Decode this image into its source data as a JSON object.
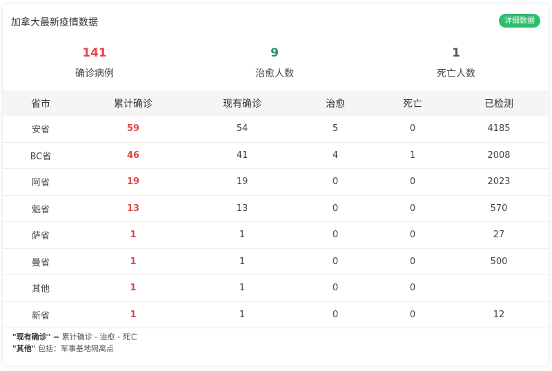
{
  "colors": {
    "confirmed": "#e64545",
    "cured": "#2a8d5c",
    "deaths": "#555555",
    "detail_button": "#2ebd6b"
  },
  "header": {
    "title": "加拿大最新疫情数据",
    "detail_button": "详细数据"
  },
  "summary": {
    "confirmed": {
      "value": "141",
      "label": "确诊病例"
    },
    "cured": {
      "value": "9",
      "label": "治愈人数"
    },
    "deaths": {
      "value": "1",
      "label": "死亡人数"
    }
  },
  "table": {
    "columns": [
      "省市",
      "累计确诊",
      "现有确诊",
      "治愈",
      "死亡",
      "已检测"
    ],
    "rows": [
      [
        "安省",
        "59",
        "54",
        "5",
        "0",
        "4185"
      ],
      [
        "BC省",
        "46",
        "41",
        "4",
        "1",
        "2008"
      ],
      [
        "阿省",
        "19",
        "19",
        "0",
        "0",
        "2023"
      ],
      [
        "魁省",
        "13",
        "13",
        "0",
        "0",
        "570"
      ],
      [
        "萨省",
        "1",
        "1",
        "0",
        "0",
        "27"
      ],
      [
        "曼省",
        "1",
        "1",
        "0",
        "0",
        "500"
      ],
      [
        "其他",
        "1",
        "1",
        "0",
        "0",
        ""
      ],
      [
        "新省",
        "1",
        "1",
        "0",
        "0",
        "12"
      ]
    ]
  },
  "notes": {
    "note1_term": "\"现有确诊\"",
    "note1_text": " = 累计确诊 - 治愈 - 死亡",
    "note2_term": "\"其他\"",
    "note2_text": " 包括：军事基地隔离点"
  }
}
